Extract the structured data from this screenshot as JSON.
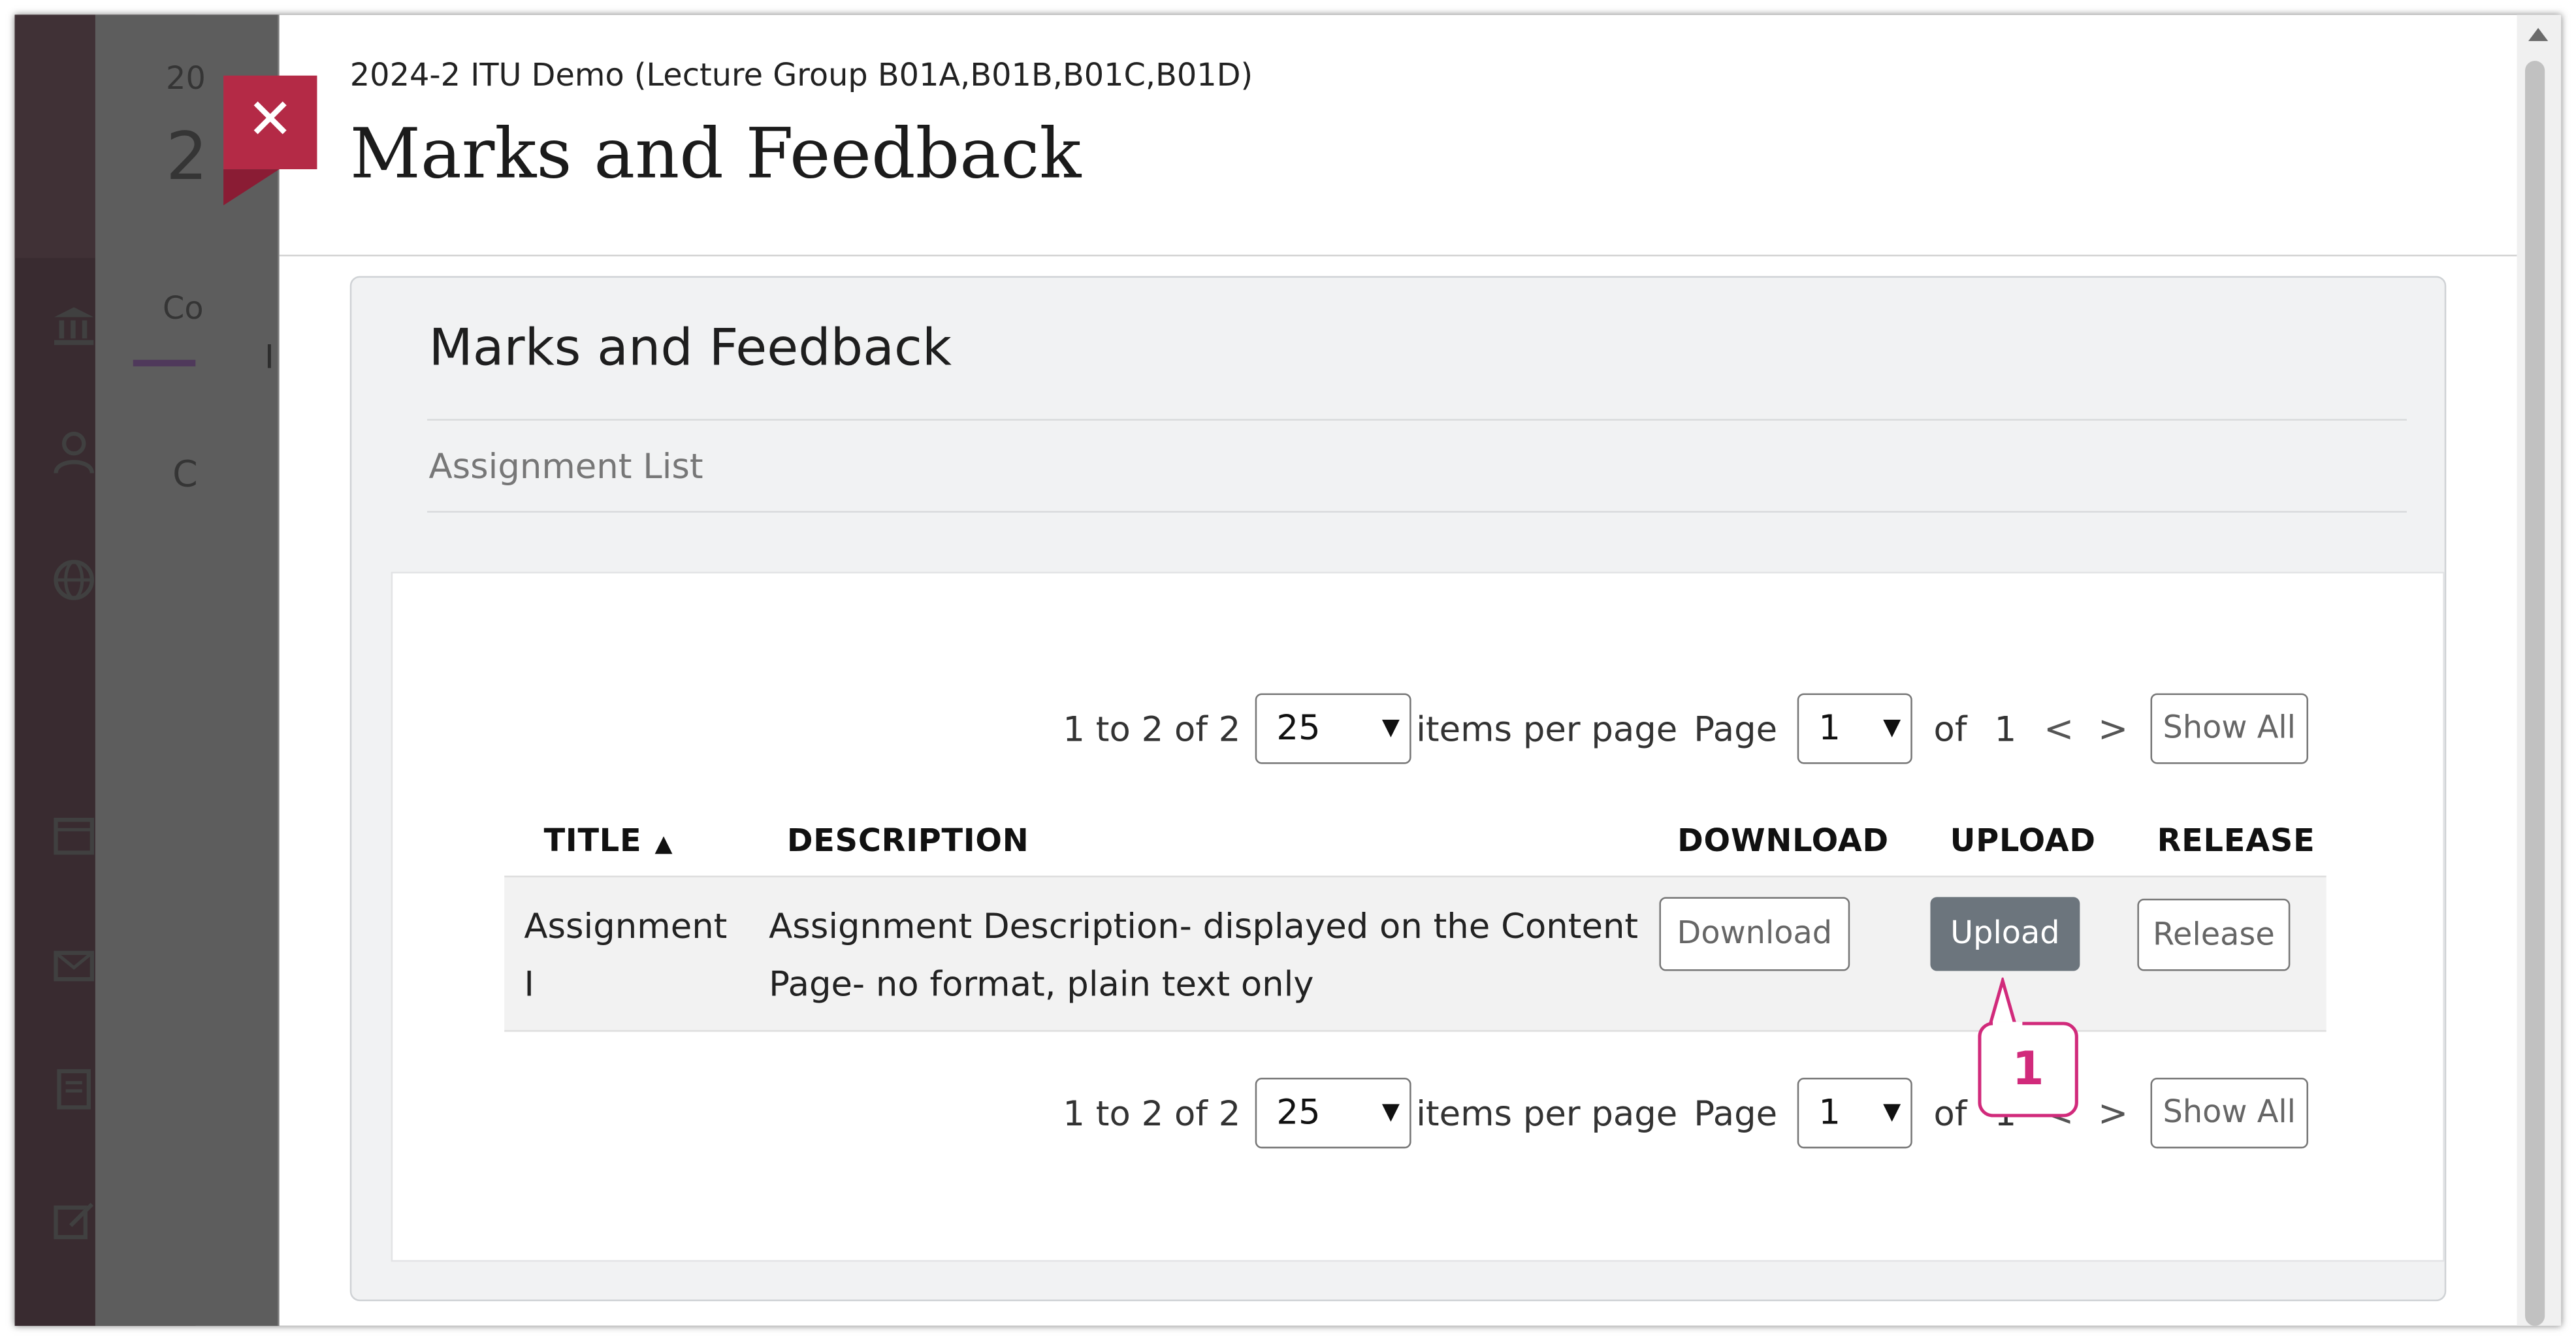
{
  "background": {
    "course_year_partial": "20",
    "course_title_partial": "2",
    "tab_partial": "Co",
    "tab_partial_2": "I",
    "content_partial": "C"
  },
  "modal": {
    "breadcrumb": "2024-2 ITU Demo (Lecture Group B01A,B01B,B01C,B01D)",
    "title": "Marks and Feedback",
    "close_symbol": "✕"
  },
  "card": {
    "title": "Marks and Feedback",
    "subheading": "Assignment List"
  },
  "pager_top": {
    "range": "1 to 2 of 2",
    "per_page_value": "25",
    "per_page_label": "items per page",
    "page_label": "Page",
    "page_value": "1",
    "of_label": "of",
    "total_pages": "1",
    "prev": "<",
    "next": ">",
    "show_all": "Show All"
  },
  "pager_bottom": {
    "range": "1 to 2 of 2",
    "per_page_value": "25",
    "per_page_label": "items per page",
    "page_label": "Page",
    "page_value": "1",
    "of_label": "of",
    "total_pages": "1",
    "prev": "<",
    "next": ">",
    "show_all": "Show All"
  },
  "table": {
    "columns": [
      "TITLE",
      "DESCRIPTION",
      "DOWNLOAD",
      "UPLOAD",
      "RELEASE"
    ],
    "sort_indicator": "▲",
    "rows": [
      {
        "title_line1": "Assignment",
        "title_line2": "I",
        "description_line1": "Assignment Description- displayed on the Content",
        "description_line2": "Page- no format, plain text only",
        "download_label": "Download",
        "upload_label": "Upload",
        "release_label": "Release"
      }
    ]
  },
  "callout": {
    "number": "1",
    "color": "#d12a7b"
  },
  "colors": {
    "close_button": "#b42a46",
    "upload_button": "#6c757d"
  }
}
